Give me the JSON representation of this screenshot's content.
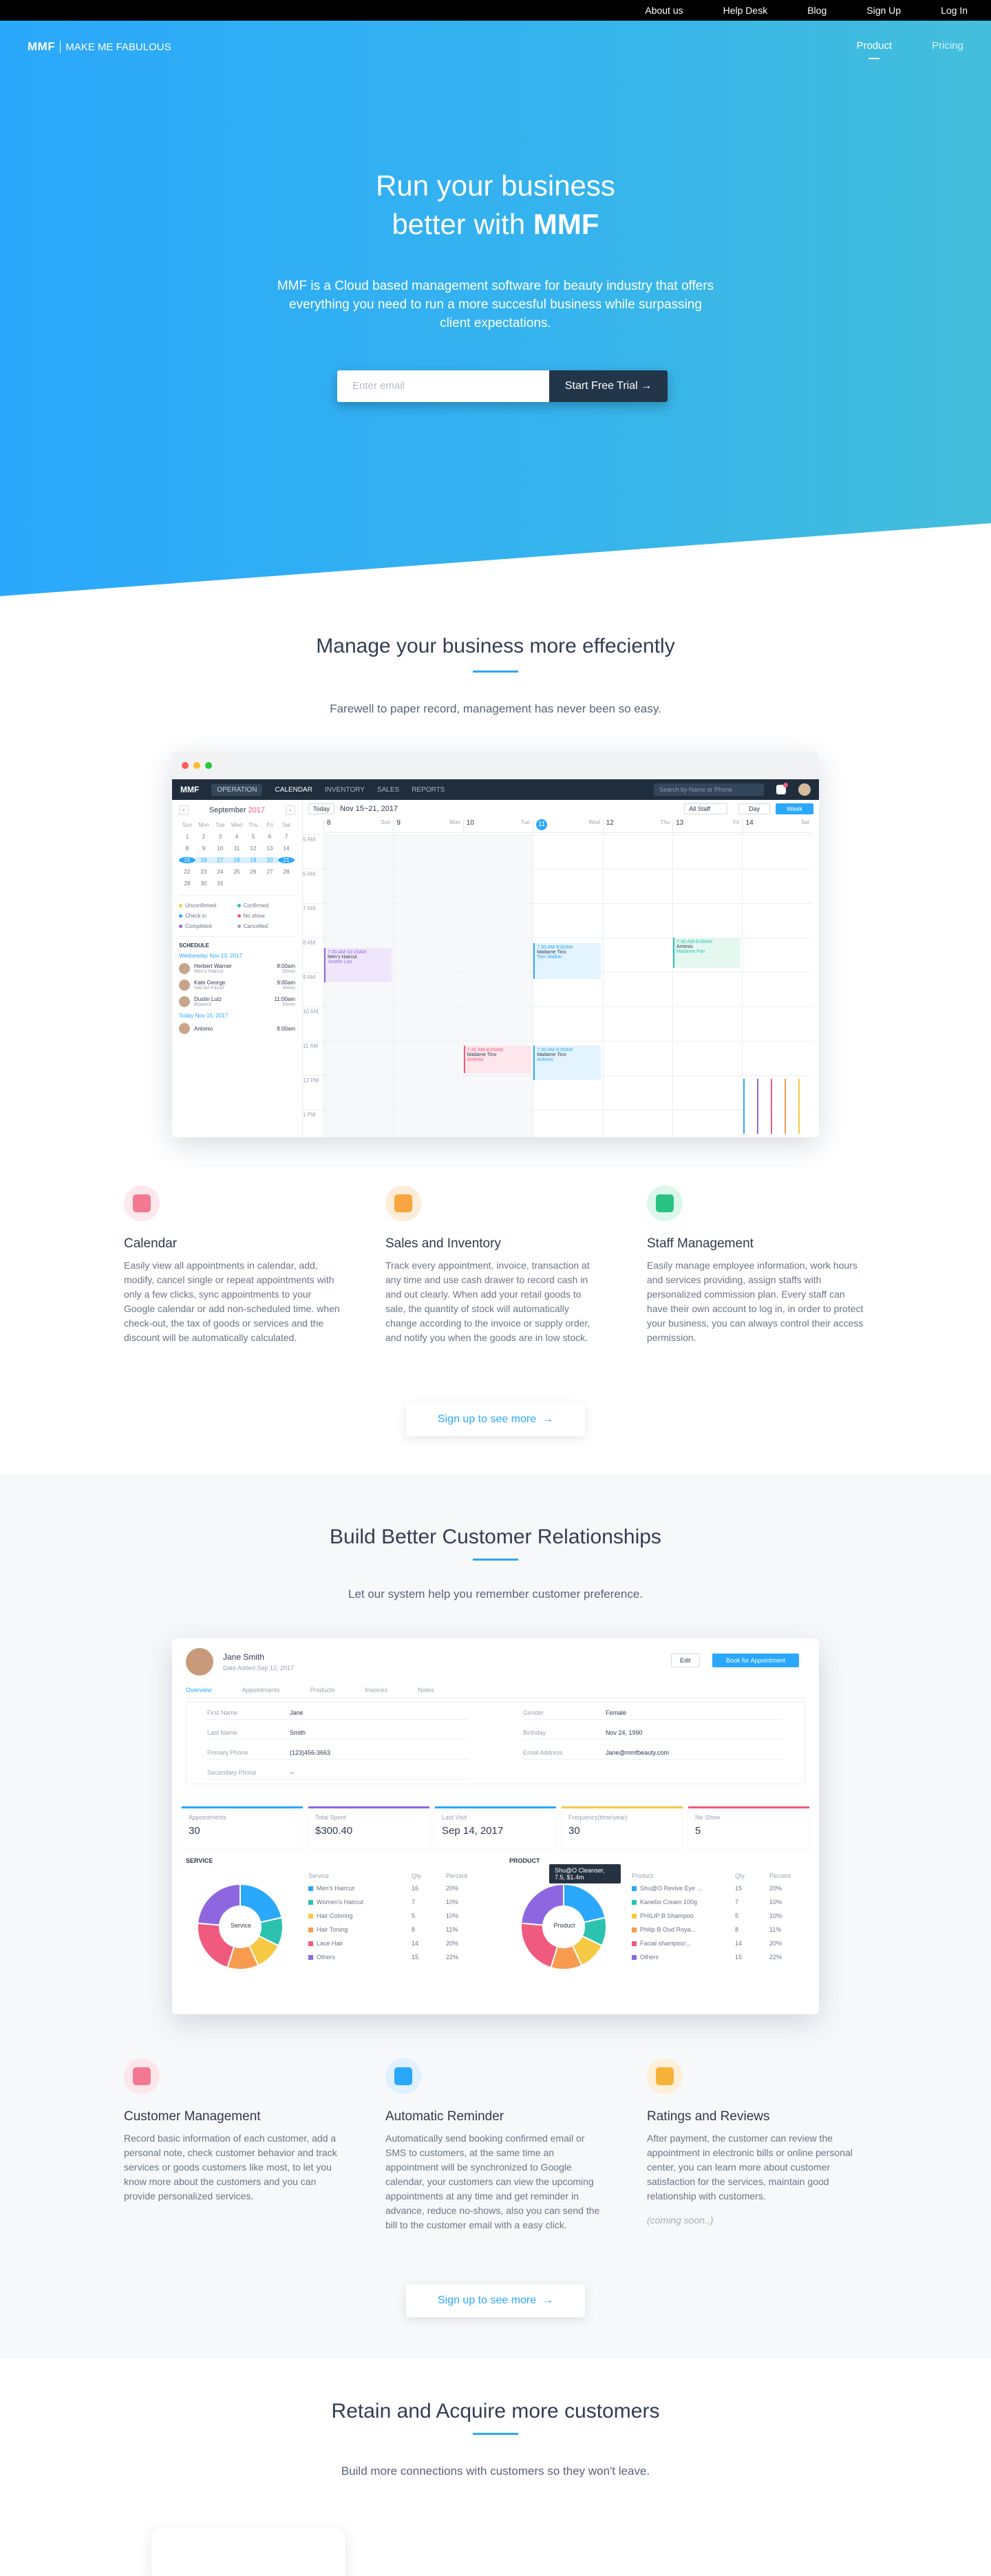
{
  "topnav": [
    "About us",
    "Help Desk",
    "Blog",
    "Sign Up",
    "Log In"
  ],
  "brand": {
    "short": "MMF",
    "name": "MAKE ME FABULOUS"
  },
  "mainnav": [
    "Product",
    "Pricing"
  ],
  "hero": {
    "line1": "Run your business",
    "line2_pre": "better with ",
    "line2_brand": "MMF",
    "desc": "MMF is a Cloud based management software for beauty industry that offers everything you need to run a more succesful business while surpassing client expectations.",
    "email_placeholder": "Enter email",
    "cta": "Start Free Trial",
    "cta_icon": "arrow-right-icon"
  },
  "s1": {
    "title": "Manage your business more effeciently",
    "sub": "Farewell to paper record, management has never been so easy."
  },
  "app": {
    "tabs": [
      "OPERATION",
      "CALENDAR",
      "INVENTORY",
      "SALES",
      "REPORTS"
    ],
    "search": "Search by Name or Phone",
    "month": "September",
    "year": "2017",
    "today": "Today",
    "range": "Nov 15~21, 2017",
    "staff": "All Staff",
    "day_btn": "Day",
    "week_btn": "Week",
    "weekdays": [
      "Sun",
      "Mon",
      "Tue",
      "Wed",
      "Thu",
      "Fri",
      "Sat"
    ],
    "dates": [
      "1",
      "2",
      "3",
      "4",
      "5",
      "6",
      "7",
      "8",
      "9",
      "10",
      "11",
      "12",
      "13",
      "14",
      "15",
      "16",
      "17",
      "18",
      "19",
      "20",
      "21",
      "22",
      "23",
      "24",
      "25",
      "26",
      "27",
      "28",
      "29",
      "30",
      "31"
    ],
    "legend": [
      "Unconfirmed",
      "Confirmed",
      "Check in",
      "No show",
      "Completed",
      "Cancelled"
    ],
    "schedule_title": "SCHEDULE",
    "sched_date": "Wednesday Nov 13, 2017",
    "today_label": "Today Nov 15, 2017",
    "sched": [
      {
        "name": "Herbert Warner",
        "svc": "Men's Haircut",
        "time": "8:00am",
        "dur": "30min"
      },
      {
        "name": "Kate George",
        "svc": "Nail Art Facial",
        "time": "9:00am",
        "dur": "30min"
      },
      {
        "name": "Dustin Lutz",
        "svc": "Blowout",
        "time": "11:00am",
        "dur": "30min"
      }
    ],
    "sched_today": [
      {
        "name": "Antonio",
        "svc": "",
        "time": "8:00am",
        "dur": ""
      }
    ],
    "days": [
      {
        "n": "8",
        "d": "Sun"
      },
      {
        "n": "9",
        "d": "Mon"
      },
      {
        "n": "10",
        "d": "Tue"
      },
      {
        "n": "11",
        "d": "Wed"
      },
      {
        "n": "12",
        "d": "Thu"
      },
      {
        "n": "13",
        "d": "Fri"
      },
      {
        "n": "14",
        "d": "Sat"
      }
    ],
    "hours": [
      "5 AM",
      "6 AM",
      "7 AM",
      "8 AM",
      "9 AM",
      "10 AM",
      "11 AM",
      "12 PM",
      "1 PM"
    ],
    "events": [
      {
        "t": "7:30 AM-10:15AM",
        "n": "Men's Haircut",
        "c": "Joselin Luo"
      },
      {
        "t": "7:30 AM-9:00AM",
        "n": "Madame Tino",
        "c": "Tom Walker"
      },
      {
        "t": "7:30 AM-8:00AM",
        "n": "Antonio",
        "c": "Madame Pan"
      },
      {
        "t": "7:30 AM-8:00AM",
        "n": "Madame Tino",
        "c": "Antonio"
      },
      {
        "t": "7:30 AM-8:00AM",
        "n": "Madame Tino",
        "c": "Antonio"
      }
    ]
  },
  "features1": [
    {
      "title": "Calendar",
      "text": "Easily view all appointments in calendar, add, modify, cancel single or repeat appointments with only a few clicks, sync appointments to your Google calendar or add non-scheduled time. when check-out, the tax of goods or services and the discount will be automatically calculated.",
      "icon": "calendar-icon"
    },
    {
      "title": "Sales and Inventory",
      "text": "Track every appointment, invoice, transaction at any time and use cash drawer to record cash in and out clearly. When add your retail goods to sale, the quantity of stock will automatically change according to the invoice or supply order, and notify you when the goods are in low stock.",
      "icon": "cart-icon"
    },
    {
      "title": "Staff Management",
      "text": "Easily manage employee information, work hours and services providing, assign staffs with personalized commission plan. Every staff can have their own account to log in, in order to protect your business, you can always control their access permission.",
      "icon": "id-card-icon"
    }
  ],
  "cta_label": "Sign up to see more",
  "s2": {
    "title": "Build Better Customer Relationships",
    "sub": "Let our system help you remember customer preference."
  },
  "crm": {
    "name": "Jane Smith",
    "since": "Date Added Sep 12, 2017",
    "edit": "Edit",
    "book": "Book for Appointment",
    "tabs": [
      "Overview",
      "Appointments",
      "Products",
      "Invoices",
      "Notes"
    ],
    "fields": [
      {
        "k": "First Name",
        "v": "Jane"
      },
      {
        "k": "Gender",
        "v": "Female"
      },
      {
        "k": "Last Name",
        "v": "Smith"
      },
      {
        "k": "Birthday",
        "v": "Nov 24, 1990"
      },
      {
        "k": "Primary Phone",
        "v": "(123)456-3663"
      },
      {
        "k": "Email Address",
        "v": "Jane@mmfbeauty.com"
      },
      {
        "k": "Secondary Phone",
        "v": "--"
      }
    ],
    "stats": [
      {
        "k": "Appointments",
        "v": "30",
        "c": "#2aa8fb"
      },
      {
        "k": "Total Spent",
        "v": "$300.40",
        "c": "#8e67e0"
      },
      {
        "k": "Last Visit",
        "v": "Sep 14, 2017",
        "c": "#2aa8fb"
      },
      {
        "k": "Frequency(time/year)",
        "v": "30",
        "c": "#f6c945"
      },
      {
        "k": "No Show",
        "v": "5",
        "c": "#f05a7e"
      }
    ],
    "service_title": "SERVICE",
    "product_title": "PRODUCT",
    "center_service": "Service",
    "center_product": "Product",
    "col_service": "Service",
    "col_qty": "Qty",
    "col_pct": "Percent",
    "col_product": "Product",
    "tooltip": "Shu@O Cleanser, 7.5, $1.4m",
    "services": [
      {
        "n": "Men's Haircut",
        "q": "16",
        "p": "20%",
        "c": "#2aa8fb"
      },
      {
        "n": "Women's Haircut",
        "q": "7",
        "p": "10%",
        "c": "#2bc3b0"
      },
      {
        "n": "Hair Coloring",
        "q": "5",
        "p": "10%",
        "c": "#f6c945"
      },
      {
        "n": "Hair Toning",
        "q": "8",
        "p": "11%",
        "c": "#f79b4f"
      },
      {
        "n": "Lace Hair",
        "q": "14",
        "p": "20%",
        "c": "#f05a7e"
      },
      {
        "n": "Others",
        "q": "15",
        "p": "22%",
        "c": "#8e67e0"
      }
    ],
    "products": [
      {
        "n": "Shu@O Revive Eye ...",
        "q": "15",
        "p": "20%",
        "c": "#2aa8fb"
      },
      {
        "n": "Kanebo Cream 100g",
        "q": "7",
        "p": "10%",
        "c": "#2bc3b0"
      },
      {
        "n": "PHILIP B Shampoo",
        "q": "5",
        "p": "10%",
        "c": "#f6c945"
      },
      {
        "n": "Philip B Oud Roya...",
        "q": "8",
        "p": "11%",
        "c": "#f79b4f"
      },
      {
        "n": "Facial shampoo/...",
        "q": "14",
        "p": "20%",
        "c": "#f05a7e"
      },
      {
        "n": "Others",
        "q": "15",
        "p": "22%",
        "c": "#8e67e0"
      }
    ]
  },
  "features2": [
    {
      "title": "Customer Management",
      "text": "Record basic information of each customer, add a personal note, check customer behavior and track services or goods customers like most, to let you know more about the customers and you can provide personalized services.",
      "icon": "users-icon",
      "soon": ""
    },
    {
      "title": "Automatic Reminder",
      "text": "Automatically send booking confirmed email or SMS to customers, at the same time an appointment will be synchronized to Google calendar, your customers can view the upcoming appointments at any time and get reminder in advance, reduce no-shows, also you can send the bill to the customer email with a easy click.",
      "icon": "mail-icon",
      "soon": ""
    },
    {
      "title": "Ratings and Reviews",
      "text": "After payment, the customer can review the appointment in electronic bills or online personal center, you can learn more about customer satisfaction for the services, maintain good relationship with customers.",
      "icon": "star-icon",
      "soon": "(coming soon..)"
    }
  ],
  "s3": {
    "title": "Retain and Acquire more customers",
    "sub": "Build more connections with customers so they won't leave."
  }
}
